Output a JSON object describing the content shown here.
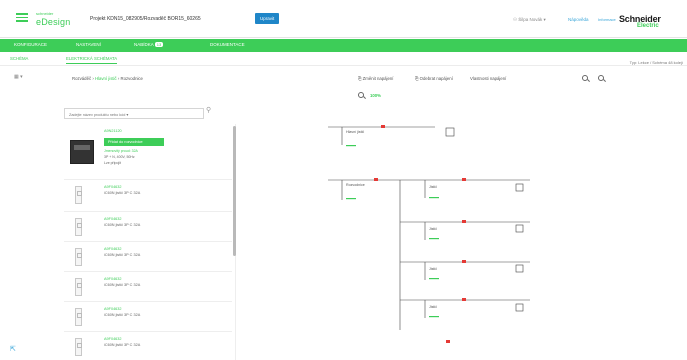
{
  "header": {
    "brand_small": "schneider",
    "brand": "eDesign",
    "project": "Projekt KDN15_082905/Rozvaděč BOR15_60265",
    "modify_label": "Upravit",
    "user": "Šilpa Novák ▾",
    "link1": "Nápověda",
    "link2": "Informace",
    "logo_line1": "Schneider",
    "logo_line2": "Electric"
  },
  "nav": {
    "items": [
      {
        "label": "Konfigurace"
      },
      {
        "label": "Nastavení"
      },
      {
        "label": "Nabídka",
        "badge": "13"
      },
      {
        "label": "Dokumentace"
      }
    ]
  },
  "subtabs": [
    {
      "label": "Schéma"
    },
    {
      "label": "Elektrická schémata"
    }
  ],
  "info_right": "Typ: Lekce / Schéma 48 kolejí",
  "toolbar": {
    "crumb_root": "Rozváděč",
    "crumb_mid": "Hlavní jistič",
    "crumb_end": "Rozvodnice",
    "action1": "Změnit napájení",
    "action2": "Odebrat napájení",
    "action3": "Vlastnosti napájení",
    "zoom": "100%"
  },
  "search": {
    "placeholder": "Zadejte název produktu nebo kód ▾"
  },
  "product_list": {
    "first": {
      "code": "A9N21120",
      "action": "Přidat do rozvodnice",
      "line1": "Jmenovitý proud: 32A",
      "line2": "3P + N, 400V, 50Hz",
      "line3": "Lze připojit"
    },
    "items": [
      {
        "code": "A9F04632",
        "desc": "iC60N jistič 3P C 32A"
      },
      {
        "code": "A9F04632",
        "desc": "iC60N jistič 3P C 32A"
      },
      {
        "code": "A9F04632",
        "desc": "iC60N jistič 3P C 32A"
      },
      {
        "code": "A9F04632",
        "desc": "iC60N jistič 3P C 32A"
      },
      {
        "code": "A9F04632",
        "desc": "iC60N jistič 3P C 32A"
      },
      {
        "code": "A9F04632",
        "desc": "iC60N jistič 3P C 32A"
      }
    ]
  },
  "diagram": {
    "top_label": "Hlavní jistič",
    "main_label": "Rozvodnice",
    "branch_label": "Jistič"
  },
  "colors": {
    "accent": "#3dcd58",
    "link": "#3aa6d9",
    "button": "#1f86c8",
    "marker": "#e53935"
  }
}
